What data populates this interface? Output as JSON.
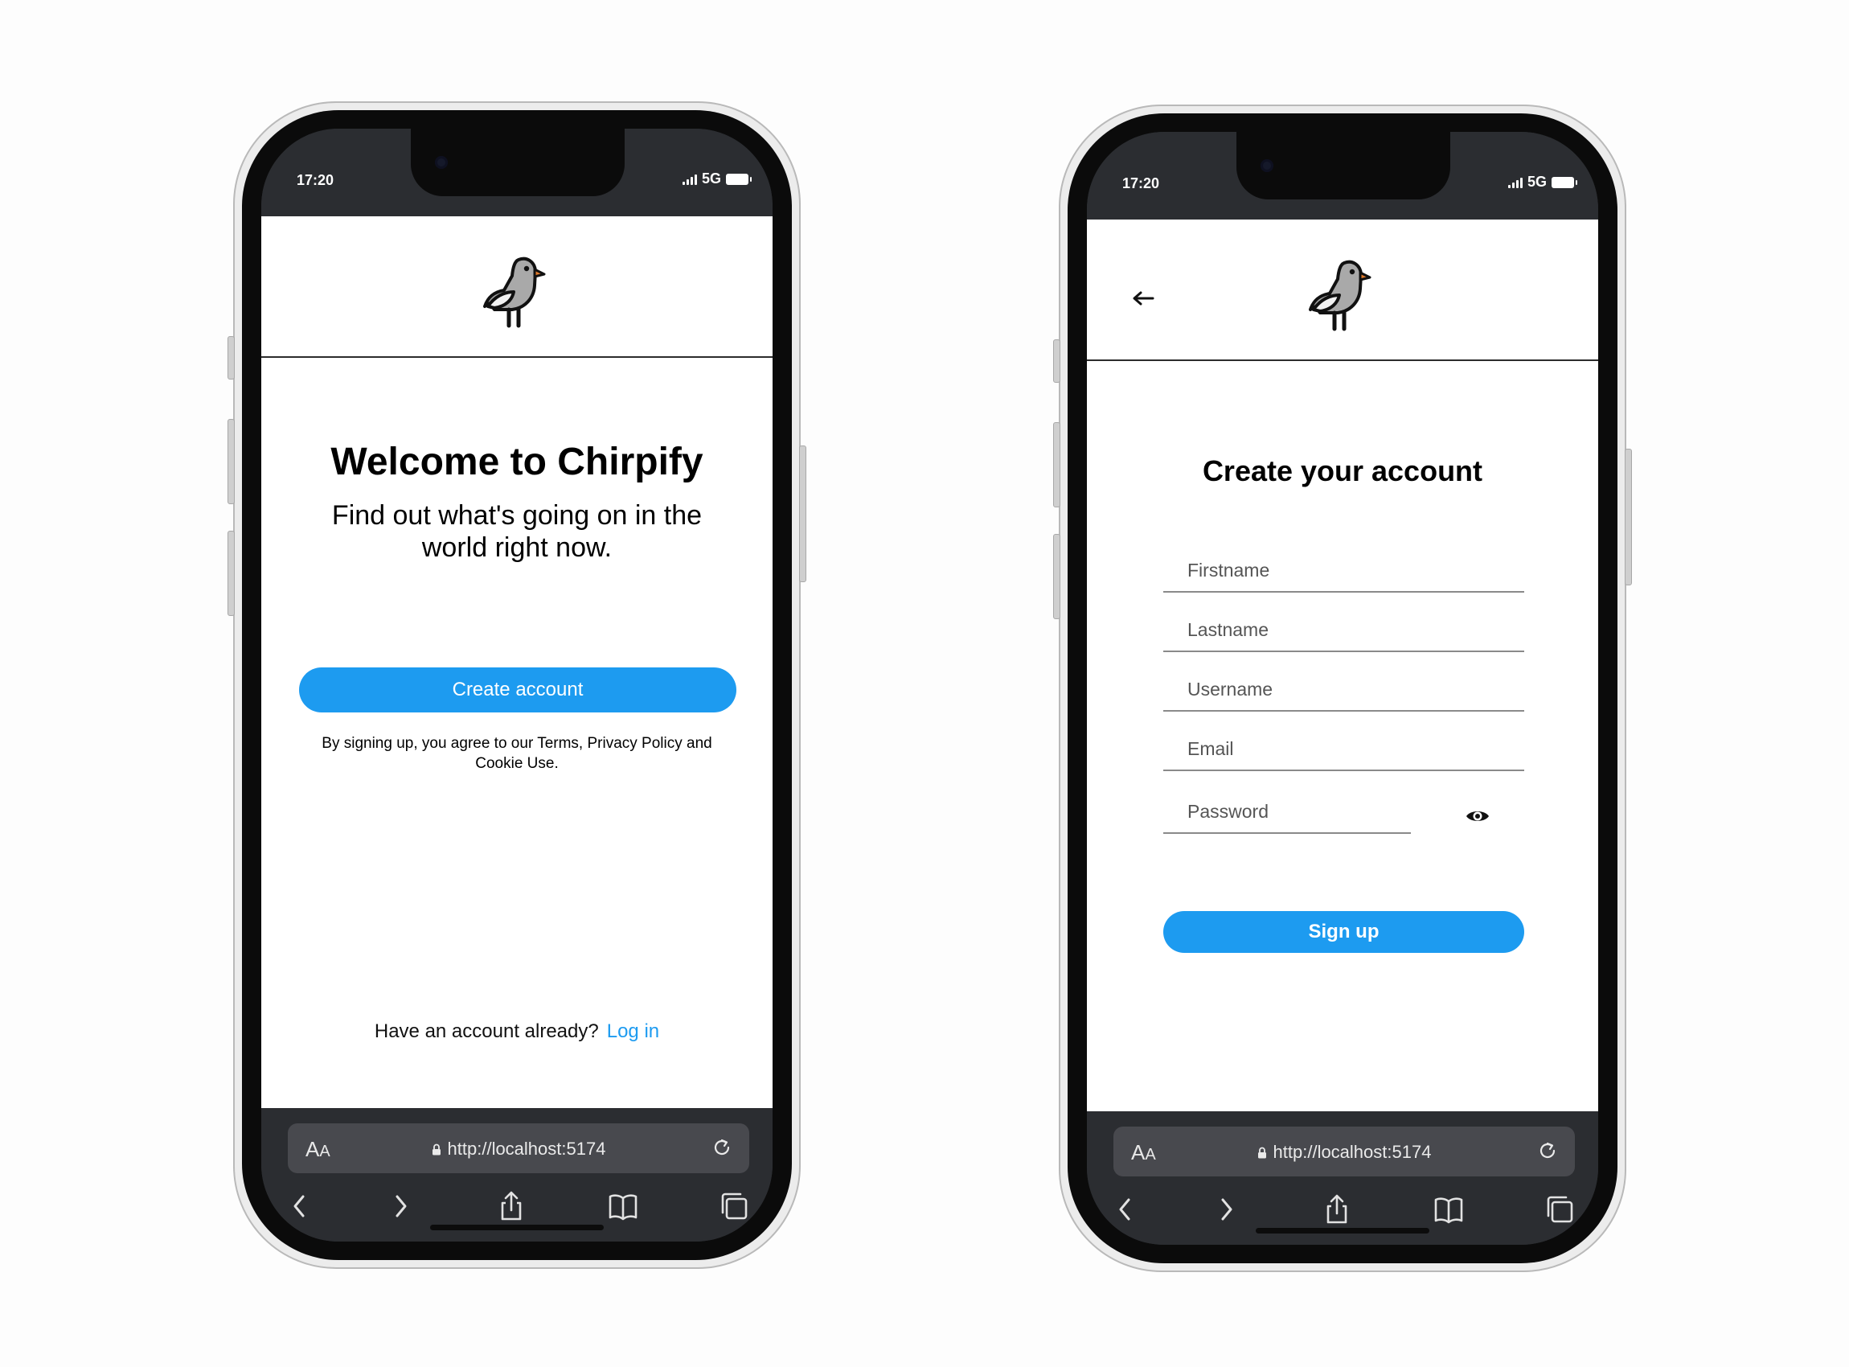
{
  "phones": [
    {
      "status": {
        "time": "17:20",
        "network": "5G"
      },
      "browser": {
        "reader_label_large": "A",
        "reader_label_small": "A",
        "url": "http://localhost:5174"
      },
      "welcome": {
        "title": "Welcome to Chirpify",
        "subtitle": "Find out what's going on in the world right now.",
        "create_account_label": "Create account",
        "terms_text": "By signing up, you agree to our Terms, Privacy Policy and Cookie Use.",
        "have_account_text": "Have an account already?",
        "login_label": "Log in"
      }
    },
    {
      "status": {
        "time": "17:20",
        "network": "5G"
      },
      "browser": {
        "reader_label_large": "A",
        "reader_label_small": "A",
        "url": "http://localhost:5174"
      },
      "signup": {
        "title": "Create your account",
        "firstname_placeholder": "Firstname",
        "lastname_placeholder": "Lastname",
        "username_placeholder": "Username",
        "email_placeholder": "Email",
        "password_placeholder": "Password",
        "signup_label": "Sign up"
      }
    }
  ],
  "colors": {
    "accent": "#1d9bf0",
    "browser_chrome": "#2b2d31",
    "url_field": "#48494e"
  },
  "icons": [
    "bird-logo-icon",
    "back-arrow-icon",
    "eye-icon",
    "lock-icon",
    "reload-icon",
    "chevron-left-icon",
    "chevron-right-icon",
    "share-icon",
    "bookmarks-icon",
    "tabs-icon",
    "signal-icon",
    "battery-icon"
  ]
}
